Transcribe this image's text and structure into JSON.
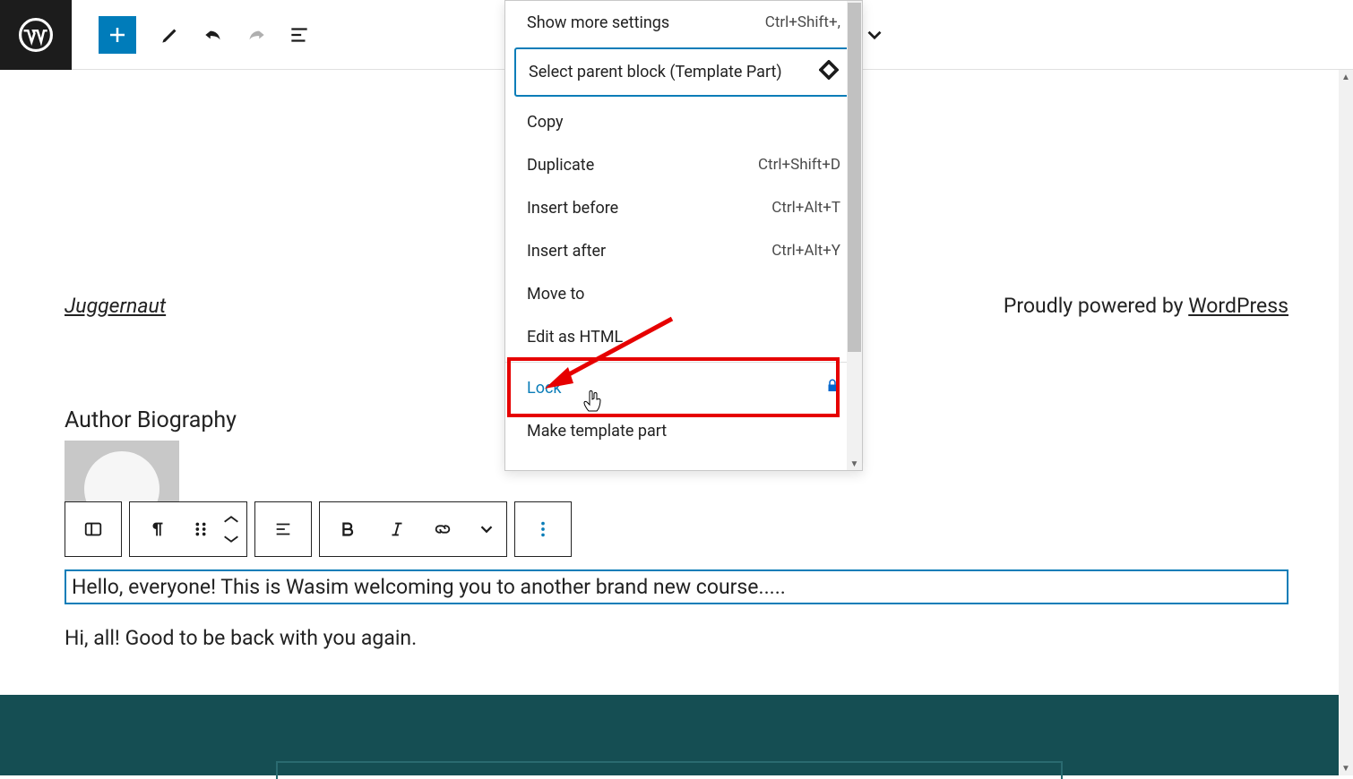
{
  "toolbar": {
    "chevron_label": "down"
  },
  "menu": {
    "show_more": "Show more settings",
    "show_more_sc": "Ctrl+Shift+,",
    "select_parent": "Select parent block (Template Part)",
    "copy": "Copy",
    "duplicate": "Duplicate",
    "duplicate_sc": "Ctrl+Shift+D",
    "insert_before": "Insert before",
    "insert_before_sc": "Ctrl+Alt+T",
    "insert_after": "Insert after",
    "insert_after_sc": "Ctrl+Alt+Y",
    "move_to": "Move to",
    "edit_html": "Edit as HTML",
    "lock": "Lock",
    "make_template": "Make template part"
  },
  "site": {
    "title": "Juggernaut",
    "powered_prefix": "Proudly powered by ",
    "powered_link": "WordPress"
  },
  "author_section": {
    "heading": "Author Biography"
  },
  "paragraphs": {
    "p1": "Hello, everyone! This is Wasim welcoming you to another brand new course.....",
    "p2": "Hi, all! Good to be back with you again."
  }
}
